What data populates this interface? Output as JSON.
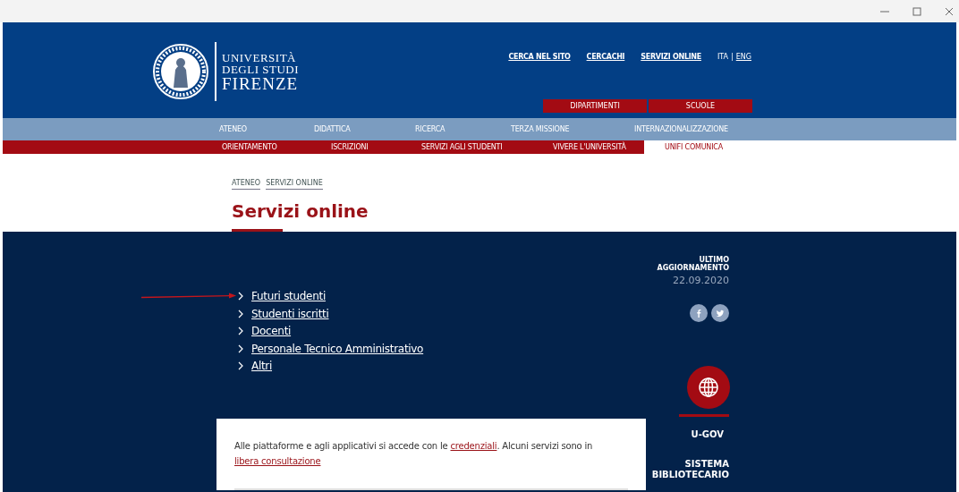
{
  "header": {
    "logo_lines": [
      "UNIVERSITÀ",
      "DEGLI STUDI",
      "FIRENZE"
    ],
    "top_links": [
      "CERCA NEL SITO",
      "CERCACHI",
      "SERVIZI ONLINE"
    ],
    "languages": [
      "ITA",
      "ENG"
    ],
    "language_separator": "|",
    "red_tabs": [
      "DIPARTIMENTI",
      "SCUOLE"
    ]
  },
  "main_nav": [
    "ATENEO",
    "DIDATTICA",
    "RICERCA",
    "TERZA MISSIONE",
    "INTERNAZIONALIZZAZIONE"
  ],
  "sub_nav": [
    {
      "label": "ORIENTAMENTO",
      "selected": false
    },
    {
      "label": "ISCRIZIONI",
      "selected": false
    },
    {
      "label": "SERVIZI AGLI STUDENTI",
      "selected": false
    },
    {
      "label": "VIVERE L'UNIVERSITÀ",
      "selected": false
    },
    {
      "label": "UNIFI COMUNICA",
      "selected": true
    }
  ],
  "breadcrumb": [
    "ATENEO",
    "SERVIZI ONLINE"
  ],
  "page_title": "Servizi online",
  "links": [
    "Futuri studenti",
    "Studenti iscritti",
    "Docenti",
    "Personale Tecnico Amministrativo",
    "Altri"
  ],
  "sidebar": {
    "updated_label": "ULTIMO AGGIORNAMENTO",
    "updated_date": "22.09.2020",
    "ugov_label": "U-GOV",
    "library_label": "SISTEMA BIBLIOTECARIO"
  },
  "notice": {
    "before": "Alle piattaforme e agli applicativi si accede con le ",
    "link1": "credenziali",
    "middle": ". Alcuni servizi sono in ",
    "link2": "libera consultazione"
  }
}
